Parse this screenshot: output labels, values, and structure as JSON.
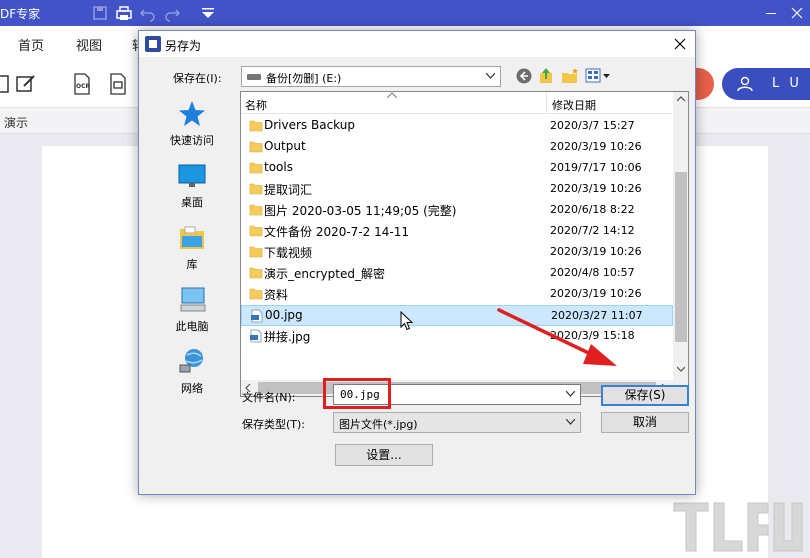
{
  "app": {
    "title": "DF专家",
    "menus": [
      "首页",
      "视图",
      "转"
    ],
    "doc_tab": "演示",
    "login_label": "L U",
    "toolbar_labels": {
      "ocr": "OCR"
    }
  },
  "dialog": {
    "title": "另存为",
    "save_in_label": "保存在(I):",
    "location": "备份[勿删] (E:)",
    "places": [
      {
        "label": "快速访问",
        "icon": "star-icon"
      },
      {
        "label": "桌面",
        "icon": "desktop-icon"
      },
      {
        "label": "库",
        "icon": "library-icon"
      },
      {
        "label": "此电脑",
        "icon": "computer-icon"
      },
      {
        "label": "网络",
        "icon": "network-icon"
      }
    ],
    "columns": {
      "name": "名称",
      "date": "修改日期"
    },
    "files": [
      {
        "name": "Drivers Backup",
        "date": "2020/3/7 15:27",
        "type": "folder"
      },
      {
        "name": "Output",
        "date": "2020/3/19 10:26",
        "type": "folder"
      },
      {
        "name": "tools",
        "date": "2019/7/17 10:06",
        "type": "folder"
      },
      {
        "name": "提取词汇",
        "date": "2020/3/19 10:26",
        "type": "folder"
      },
      {
        "name": "图片 2020-03-05 11;49;05 (完整)",
        "date": "2020/6/18 8:22",
        "type": "folder"
      },
      {
        "name": "文件备份 2020-7-2 14-11",
        "date": "2020/7/2 14:12",
        "type": "folder"
      },
      {
        "name": "下载视频",
        "date": "2020/3/19 10:26",
        "type": "folder"
      },
      {
        "name": "演示_encrypted_解密",
        "date": "2020/4/8 10:57",
        "type": "folder"
      },
      {
        "name": "资料",
        "date": "2020/3/19 10:26",
        "type": "folder"
      },
      {
        "name": "00.jpg",
        "date": "2020/3/27 11:07",
        "type": "jpg",
        "selected": true
      },
      {
        "name": "拼接.jpg",
        "date": "2020/3/9 15:18",
        "type": "jpg"
      }
    ],
    "filename_label": "文件名(N):",
    "filename_value": "00.jpg",
    "filetype_label": "保存类型(T):",
    "filetype_value": "图片文件(*.jpg)",
    "save_button": "保存(S)",
    "cancel_button": "取消",
    "settings_button": "设置..."
  },
  "colors": {
    "titlebar": "#4253c8",
    "selection": "#cce8ff",
    "highlight": "#e02020",
    "folder": "#f5cc5a"
  }
}
